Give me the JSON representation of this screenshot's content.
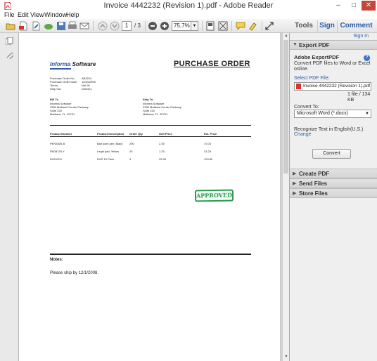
{
  "window": {
    "title": "Invoice 4442232 (Revision 1).pdf - Adobe Reader",
    "controls": {
      "minimize": "–",
      "maximize": "□",
      "close": "✕"
    }
  },
  "menu": [
    "File",
    "Edit",
    "View",
    "Window",
    "Help"
  ],
  "toolbar": {
    "page_current": "1",
    "page_total": "/ 3",
    "zoom": "75.7%",
    "tabs": {
      "tools": "Tools",
      "sign": "Sign",
      "comment": "Comment"
    },
    "icons": [
      "open-icon",
      "create-pdf-icon",
      "edit-icon",
      "cloud-icon",
      "save-icon",
      "print-icon",
      "email-icon",
      "prev-page-icon",
      "next-page-icon",
      "zoom-out-icon",
      "zoom-in-icon",
      "fit-page-icon",
      "fullscreen-icon",
      "comment-icon",
      "highlight-icon",
      "sign-icon",
      "expand-icon"
    ]
  },
  "document": {
    "company": {
      "strong": "Informa",
      "rest": " Software"
    },
    "title": "PURCHASE ORDER",
    "meta_labels": "Purchase Order No:\nPurchase Order Date:\nTerms:\nShip Via:",
    "meta_values": "AB3224\n11/30/2008\nNet 30\nDelivery",
    "bill_to": {
      "heading": "Bill To",
      "address": "Informa Software\n2300 Maitland Center Parkway\nSuite 220\nMaitland, FL  32751"
    },
    "ship_to": {
      "heading": "Ship To",
      "address": "Informa Software\n2300 Maitland Center Parkway\nSuite 220\nMaitland, FL  32751"
    },
    "table": {
      "headers": [
        "Product Number",
        "Product Description",
        "Order Qty.",
        "Unit Price",
        "Ext. Price"
      ],
      "rows": [
        [
          "PEN3406-B",
          "Ball point pen, Black",
          "200",
          "2.35",
          "70.00"
        ],
        [
          "PAD8733-Y",
          "Legal pad, Yellow",
          "25",
          "1.25",
          "31.25"
        ],
        [
          "DVD4211",
          "DVD 10 Pack",
          "4",
          "25.95",
          "103.80"
        ]
      ]
    },
    "stamp": "APPROVED",
    "notes_label": "Notes:",
    "notes_text": "Please ship by 12/1/2008."
  },
  "right_pane": {
    "sign_in": "Sign In",
    "export_pdf": {
      "header": "Export PDF",
      "product": "Adobe ExportPDF",
      "description": "Convert PDF files to Word or Excel online.",
      "select_label": "Select PDF File:",
      "file_name": "Invoice 4442232 (Revision 1).pdf",
      "file_info": "1 file / 134 KB",
      "convert_to_label": "Convert To:",
      "convert_to_value": "Microsoft Word (*.docx)",
      "recognize_text": "Recognize Text in English(U.S.)",
      "change_link": "Change",
      "convert_button": "Convert"
    },
    "sections": [
      "Create PDF",
      "Send Files",
      "Store Files"
    ]
  }
}
